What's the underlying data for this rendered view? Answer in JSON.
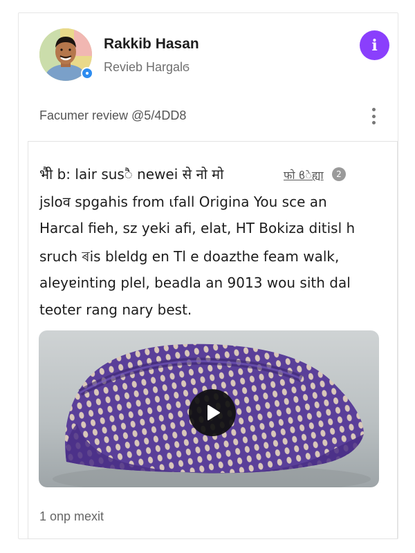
{
  "reviewer": {
    "name": "Rakkib Hasan",
    "subtitle": "Revieb Hargalϭ"
  },
  "info_button_label": "i",
  "review": {
    "meta": "Facumer review @5/4DD8",
    "tag_text": "फो ϐेह्या",
    "tag_count": "2",
    "lines": [
      "भैी b: lair susै newei से नो मो",
      "jsloव spgahis from ɩfall Origina You sce an",
      "Harcal fieh, sz yeki afi, elat, HT Bokiza ditisl h",
      "sruch ৰis bleldg en Tl e doazthe feam walk,",
      "aleyɐinting plel, beadla an 9013 wou sith dal",
      "teoter rang nary best."
    ]
  },
  "media": {
    "subject": "purple knitted beanie",
    "play_icon": "play-icon"
  },
  "footer": {
    "note": "1 onp mexit"
  },
  "colors": {
    "accent": "#8a3ffc",
    "verified": "#2d8cf0",
    "knit_primary": "#5a3f99",
    "knit_stitch": "#d9c7b9"
  }
}
